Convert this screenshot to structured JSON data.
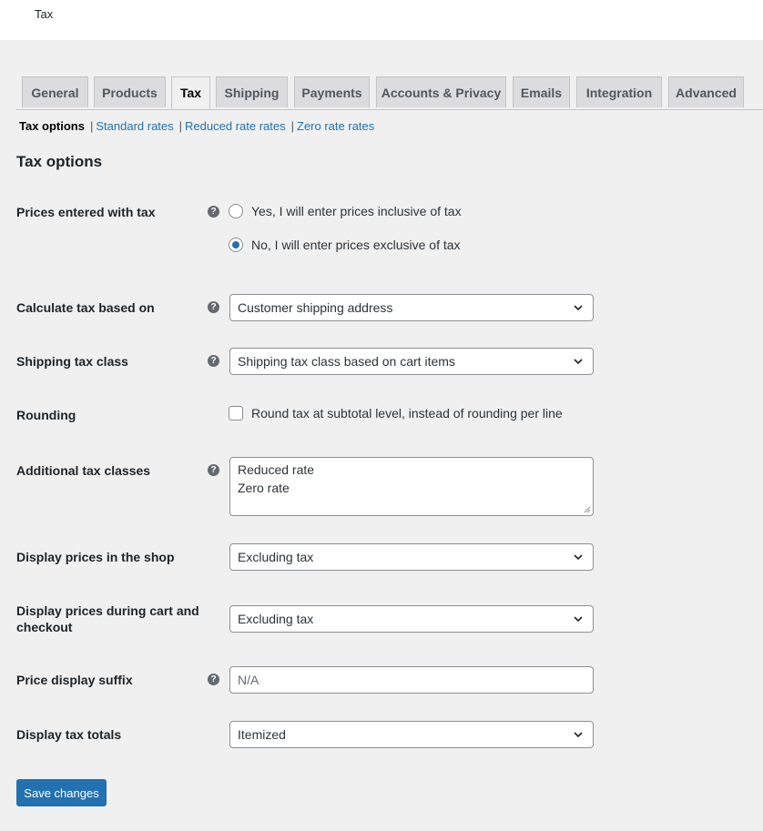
{
  "header": {
    "page_name": "Tax"
  },
  "tabs": [
    {
      "label": "General"
    },
    {
      "label": "Products"
    },
    {
      "label": "Tax",
      "active": true
    },
    {
      "label": "Shipping"
    },
    {
      "label": "Payments"
    },
    {
      "label": "Accounts & Privacy"
    },
    {
      "label": "Emails"
    },
    {
      "label": "Integration"
    },
    {
      "label": "Advanced"
    }
  ],
  "subnav": {
    "current": "Tax options",
    "links": [
      "Standard rates",
      "Reduced rate rates",
      "Zero rate rates"
    ]
  },
  "section_title": "Tax options",
  "fields": {
    "prices_entered": {
      "label": "Prices entered with tax",
      "options": [
        {
          "label": "Yes, I will enter prices inclusive of tax",
          "checked": false
        },
        {
          "label": "No, I will enter prices exclusive of tax",
          "checked": true
        }
      ]
    },
    "calc_based_on": {
      "label": "Calculate tax based on",
      "value": "Customer shipping address"
    },
    "shipping_tax_class": {
      "label": "Shipping tax class",
      "value": "Shipping tax class based on cart items"
    },
    "rounding": {
      "label": "Rounding",
      "checkbox_label": "Round tax at subtotal level, instead of rounding per line",
      "checked": false
    },
    "additional_classes": {
      "label": "Additional tax classes",
      "lines": [
        "Reduced rate",
        "Zero rate"
      ]
    },
    "display_shop": {
      "label": "Display prices in the shop",
      "value": "Excluding tax"
    },
    "display_cart": {
      "label": "Display prices during cart and checkout",
      "value": "Excluding tax"
    },
    "price_suffix": {
      "label": "Price display suffix",
      "placeholder": "N/A"
    },
    "display_totals": {
      "label": "Display tax totals",
      "value": "Itemized"
    }
  },
  "help_icon_glyph": "?",
  "save_button": "Save changes",
  "colors": {
    "accent": "#2271b1",
    "background": "#f0f0f1"
  }
}
